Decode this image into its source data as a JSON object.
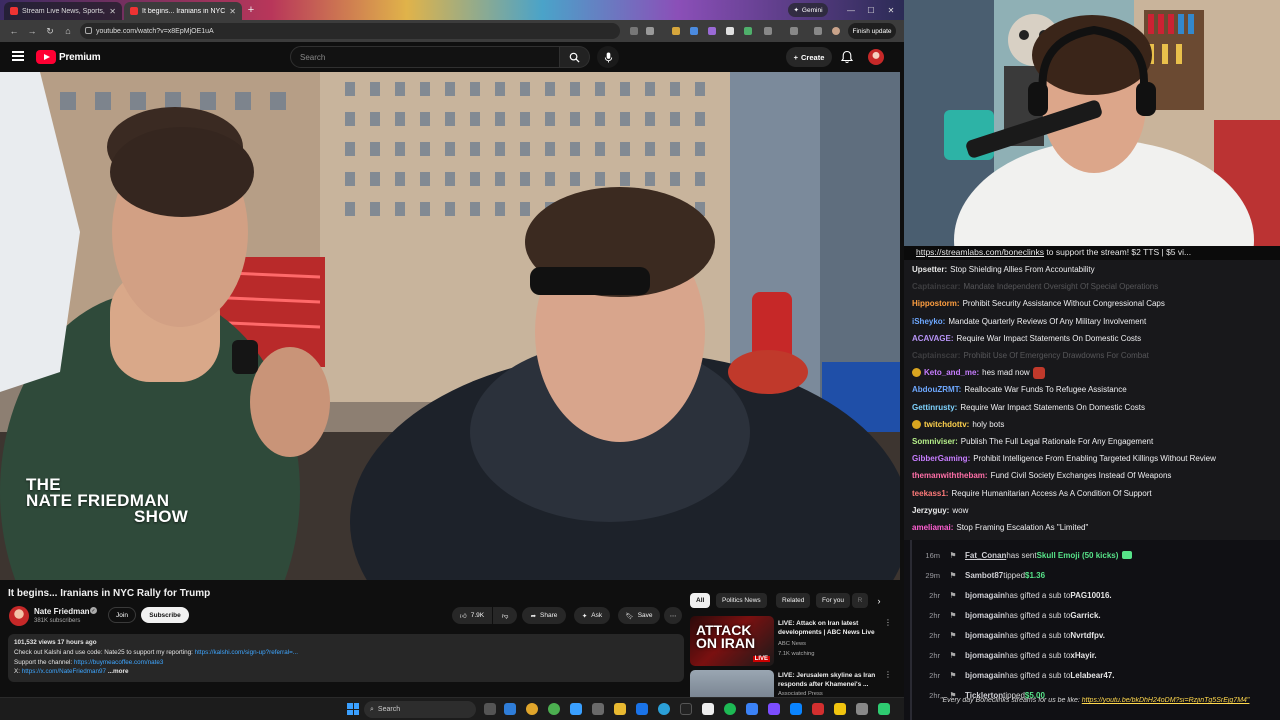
{
  "browser": {
    "tabs": [
      {
        "title": "Stream Live News, Sports,"
      },
      {
        "title": "It begins... Iranians in NYC"
      }
    ],
    "gemini_label": "Gemini",
    "url": "youtube.com/watch?v=x8EpMjOE1uA",
    "finish_update_label": "Finish update"
  },
  "youtube": {
    "logo_text": "Premium",
    "search_placeholder": "Search",
    "create_label": "Create",
    "video": {
      "watermark_lines": [
        "THE",
        "NATE FRIEDMAN",
        "SHOW"
      ],
      "title": "It begins... Iranians in NYC Rally for Trump",
      "channel": "Nate Friedman",
      "subscribers": "381K subscribers",
      "join_label": "Join",
      "subscribe_label": "Subscribe",
      "likes": "7.9K",
      "share_label": "Share",
      "ask_label": "Ask",
      "save_label": "Save",
      "description": {
        "meta": "101,532 views  17 hours ago",
        "line1_text": "Check out Kalshi and use code: Nate25 to support my reporting: ",
        "line1_link": "https://kalshi.com/sign-up?referral=...",
        "line2_text": "Support the channel: ",
        "line2_link": "https://buymeacoffee.com/nate3",
        "line3_text": "X: ",
        "line3_link": "https://x.com/NateFriedman97",
        "more_label": "...more"
      }
    },
    "chips": [
      "All",
      "Politics News",
      "Related",
      "For you",
      "R"
    ],
    "related": [
      {
        "thumb_text": "ATTACK ON IRAN",
        "thumb_badge": "LIVE",
        "title": "LIVE: Attack on Iran latest developments | ABC News Live",
        "channel": "ABC News",
        "meta": "7.1K watching"
      },
      {
        "title": "LIVE: Jerusalem skyline as Iran responds after Khamenei's ...",
        "channel": "Associated Press"
      }
    ]
  },
  "taskbar": {
    "search_label": "Search"
  },
  "stream": {
    "ticker": {
      "url": "https://streamlabs.com/boneclinks",
      "text": " to support the stream! $2 TTS | $5 vi..."
    },
    "chat": [
      {
        "user": "Upsetter",
        "color": "#e8e8e8",
        "text": "Stop Shielding Allies From Accountability",
        "faded": false
      },
      {
        "user": "Captainscar",
        "color": "#9b9b9b",
        "text": "Mandate Independent Oversight Of Special Operations",
        "faded": true
      },
      {
        "user": "Hippostorm",
        "color": "#ff9f40",
        "text": "Prohibit Security Assistance Without Congressional Caps",
        "faded": false
      },
      {
        "user": "iSheyko",
        "color": "#6ea8ff",
        "text": "Mandate Quarterly Reviews Of Any Military Involvement",
        "faded": false
      },
      {
        "user": "ACAVAGE",
        "color": "#b794f6",
        "text": "Require War Impact Statements On Domestic Costs",
        "faded": false
      },
      {
        "user": "Captainscar",
        "color": "#9b9b9b",
        "text": "Prohibit Use Of Emergency Drawdowns For Combat",
        "faded": true
      },
      {
        "user": "Keto_and_me",
        "color": "#c77dff",
        "text": "hes mad now",
        "faded": false,
        "badge": "coin",
        "emote": true
      },
      {
        "user": "AbdouZRMT",
        "color": "#6ea8ff",
        "text": "Reallocate War Funds To Refugee Assistance",
        "faded": false
      },
      {
        "user": "Gettinrusty",
        "color": "#7fd3ff",
        "text": "Require War Impact Statements On Domestic Costs",
        "faded": false
      },
      {
        "user": "twitchdottv",
        "color": "#ffd24d",
        "text": "holy bots",
        "faded": false,
        "badge": "coin"
      },
      {
        "user": "Somniviser",
        "color": "#b6f08a",
        "text": "Publish The Full Legal Rationale For Any Engagement",
        "faded": false
      },
      {
        "user": "GibberGaming",
        "color": "#c77dff",
        "text": "Prohibit Intelligence From Enabling Targeted Killings Without Review",
        "faded": false
      },
      {
        "user": "themanwiththebam",
        "color": "#ff6fa8",
        "text": "Fund Civil Society Exchanges Instead Of Weapons",
        "faded": false
      },
      {
        "user": "teekass1",
        "color": "#ff7a7a",
        "text": "Require Humanitarian Access As A Condition Of Support",
        "faded": false
      },
      {
        "user": "Jerzyguy",
        "color": "#e8e8e8",
        "text": "wow",
        "faded": false
      },
      {
        "user": "ameliamai",
        "color": "#ff5fd2",
        "text": "Stop Framing Escalation As \"Limited\"",
        "faded": false
      }
    ],
    "events": [
      {
        "time": "16m",
        "who": "Fat_Conan",
        "action": " has sent ",
        "gift": "Skull Emoji (50 kicks)",
        "type": "kick"
      },
      {
        "time": "29m",
        "who": "Sambot87",
        "action": " tipped ",
        "amount": "$1.36",
        "type": "tip"
      },
      {
        "time": "2hr",
        "who": "bjomagain",
        "action": " has gifted a sub to ",
        "target": "PAG10016.",
        "type": "gift"
      },
      {
        "time": "2hr",
        "who": "bjomagain",
        "action": " has gifted a sub to ",
        "target": "Garrick.",
        "type": "gift"
      },
      {
        "time": "2hr",
        "who": "bjomagain",
        "action": " has gifted a sub to ",
        "target": "Nvrtdfpv.",
        "type": "gift"
      },
      {
        "time": "2hr",
        "who": "bjomagain",
        "action": " has gifted a sub to ",
        "target": "xHayir.",
        "type": "gift"
      },
      {
        "time": "2hr",
        "who": "bjomagain",
        "action": " has gifted a sub to ",
        "target": "Lelabear47.",
        "type": "gift"
      },
      {
        "time": "2hr",
        "who": "Ticklerton",
        "action": " tipped ",
        "amount": "$5.00",
        "type": "tip"
      }
    ],
    "event_sub": {
      "text": "\"Every day Boneclinks streams for us be like: ",
      "link": "https://youtu.be/bkDhH24oDM?si=RzjinTg5SrEjg7M4\""
    }
  }
}
